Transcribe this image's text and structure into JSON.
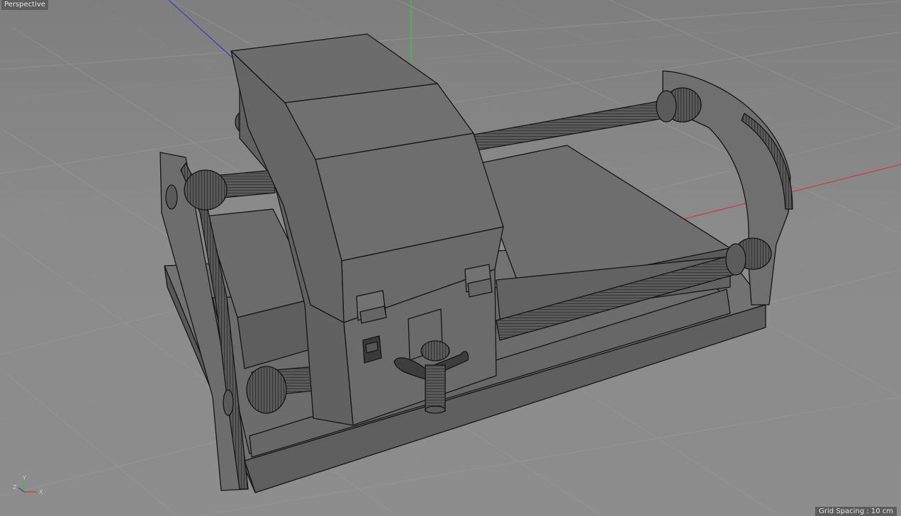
{
  "viewport": {
    "view_name": "Perspective",
    "grid_spacing_text": "Grid Spacing : 10 cm"
  },
  "axis_gizmo": {
    "x_label": "X",
    "y_label": "Y",
    "z_label": "Z",
    "x_color": "#d04040",
    "y_color": "#40c040",
    "z_color": "#4040d0"
  },
  "scene": {
    "object": "printer-model",
    "shading": "gouraud-lines",
    "body_color": "#6a6a6a",
    "wire_color": "#151515"
  }
}
